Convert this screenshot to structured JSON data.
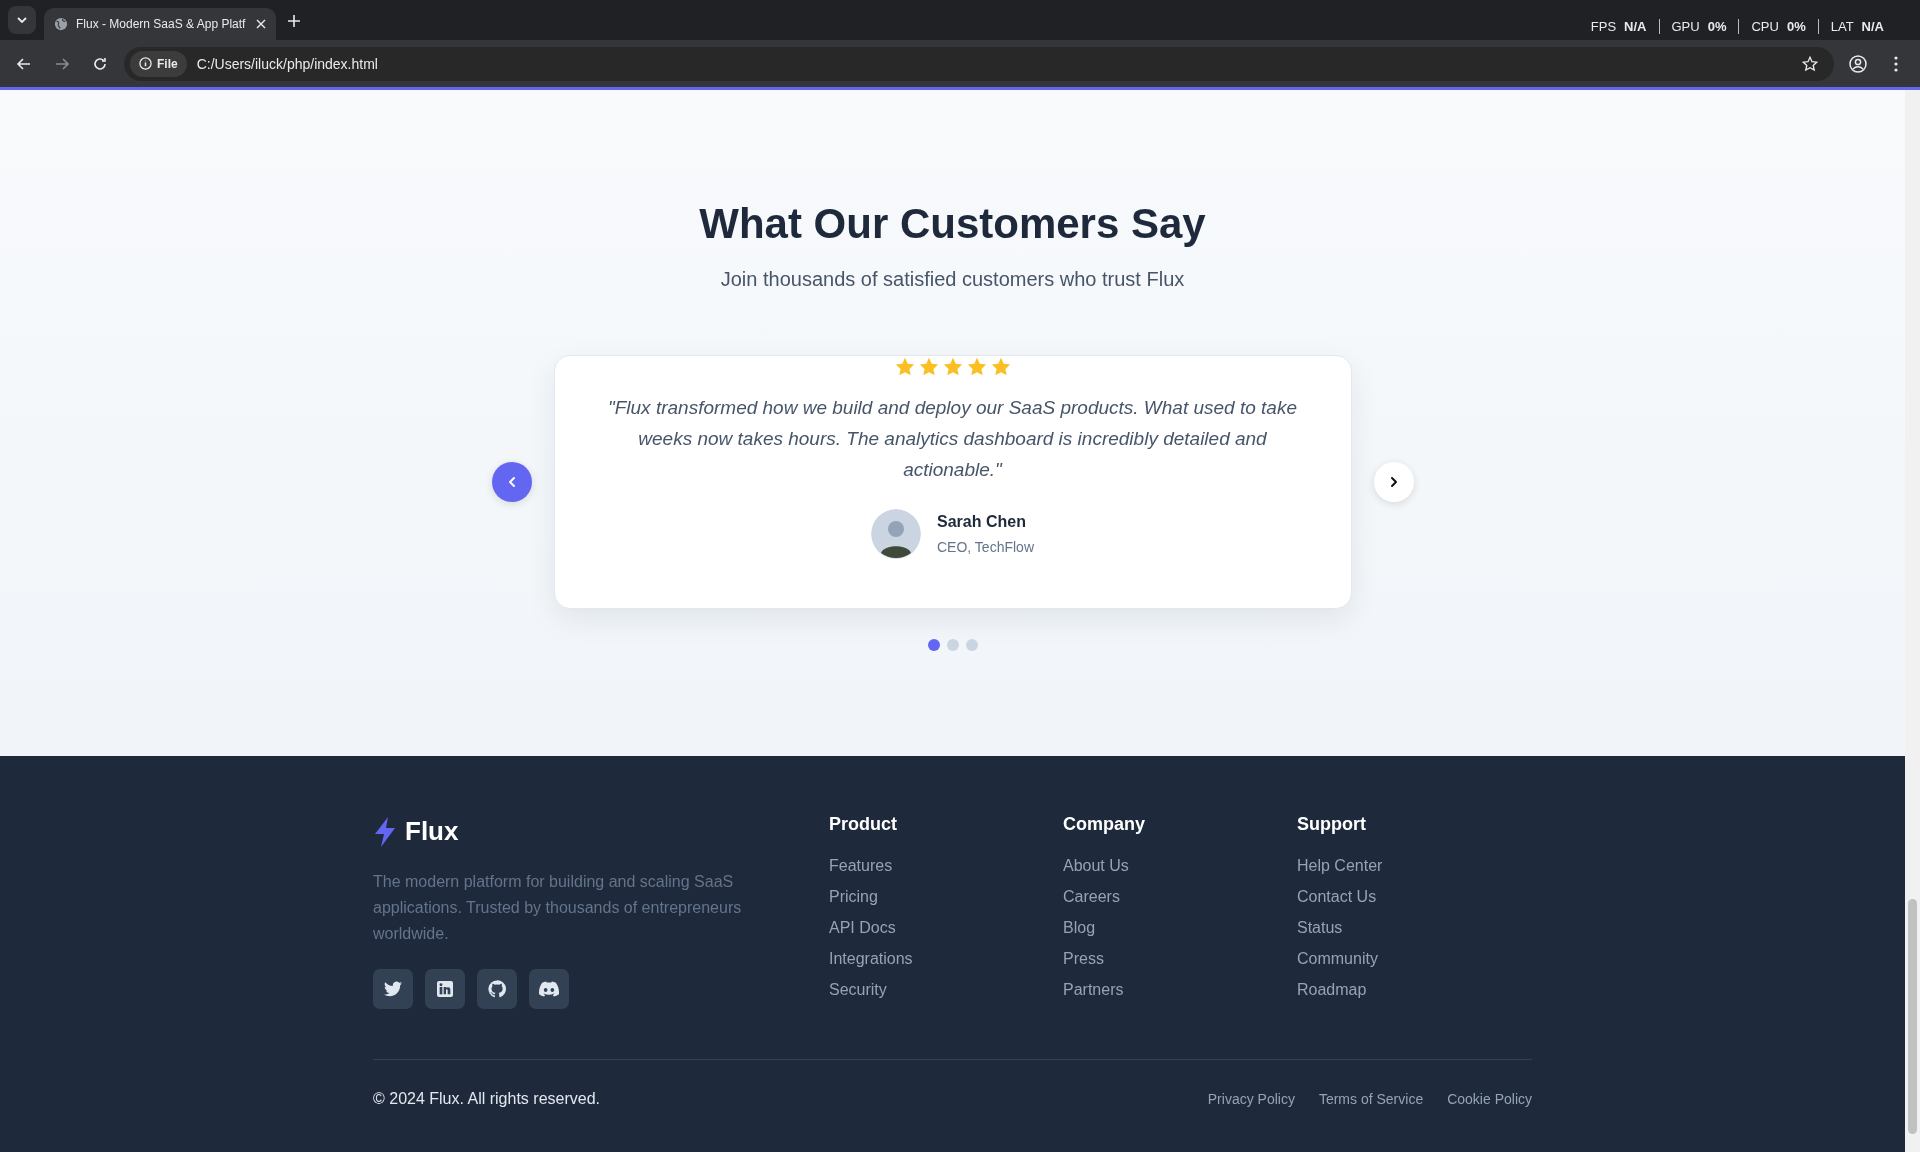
{
  "browser": {
    "tab_title": "Flux - Modern SaaS & App Platf",
    "address_chip": "File",
    "url": "C:/Users/iluck/php/index.html",
    "overlay": [
      {
        "label": "FPS",
        "value": "N/A"
      },
      {
        "label": "GPU",
        "value": "0%"
      },
      {
        "label": "CPU",
        "value": "0%"
      },
      {
        "label": "LAT",
        "value": "N/A"
      }
    ]
  },
  "testimonials": {
    "title": "What Our Customers Say",
    "subtitle": "Join thousands of satisfied customers who trust Flux",
    "card": {
      "stars": 5,
      "quote": "\"Flux transformed how we build and deploy our SaaS products. What used to take weeks now takes hours. The analytics dashboard is incredibly detailed and actionable.\"",
      "name": "Sarah Chen",
      "role": "CEO, TechFlow"
    },
    "nav_buttons": [
      {
        "kind": "prev",
        "highlighted": true
      },
      {
        "kind": "next",
        "highlighted": false
      }
    ],
    "dots": [
      {
        "selected": true
      },
      {
        "selected": false
      },
      {
        "selected": false
      }
    ]
  },
  "footer": {
    "brand": "Flux",
    "description": "The modern platform for building and scaling SaaS applications. Trusted by thousands of entrepreneurs worldwide.",
    "socials": [
      {
        "kind": "twitter"
      },
      {
        "kind": "linkedin"
      },
      {
        "kind": "github"
      },
      {
        "kind": "discord"
      }
    ],
    "columns": [
      {
        "heading": "Product",
        "links": [
          "Features",
          "Pricing",
          "API Docs",
          "Integrations",
          "Security"
        ]
      },
      {
        "heading": "Company",
        "links": [
          "About Us",
          "Careers",
          "Blog",
          "Press",
          "Partners"
        ]
      },
      {
        "heading": "Support",
        "links": [
          "Help Center",
          "Contact Us",
          "Status",
          "Community",
          "Roadmap"
        ]
      }
    ],
    "copyright": "© 2024 Flux. All rights reserved.",
    "legal_links": [
      "Privacy Policy",
      "Terms of Service",
      "Cookie Policy"
    ]
  }
}
